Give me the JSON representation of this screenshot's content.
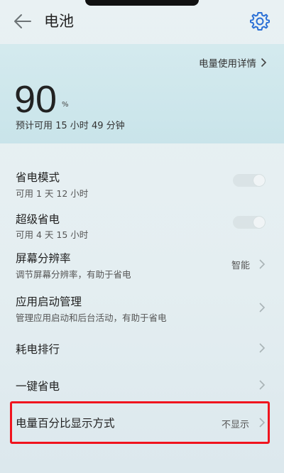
{
  "header": {
    "title": "电池",
    "back_icon": "arrow-left-icon",
    "settings_icon": "gear-icon"
  },
  "battery": {
    "detail_link": "电量使用详情",
    "percent": "90",
    "percent_unit": "%",
    "estimate": "预计可用 15 小时 49 分钟"
  },
  "settings": [
    {
      "id": "power-saving",
      "label": "省电模式",
      "sub": "可用 1 天 12 小时",
      "control": "toggle",
      "on": false
    },
    {
      "id": "ultra-power-saving",
      "label": "超级省电",
      "sub": "可用 4 天 15 小时",
      "control": "toggle",
      "on": false
    },
    {
      "id": "screen-resolution",
      "label": "屏幕分辨率",
      "sub": "调节屏幕分辨率，有助于省电",
      "value": "智能",
      "control": "chevron"
    },
    {
      "id": "app-launch",
      "label": "应用启动管理",
      "sub": "管理应用启动和后台活动，有助于省电",
      "control": "chevron"
    },
    {
      "id": "power-ranking",
      "label": "耗电排行",
      "control": "chevron"
    },
    {
      "id": "one-tap-saving",
      "label": "一键省电",
      "control": "chevron"
    },
    {
      "id": "percent-display",
      "label": "电量百分比显示方式",
      "value": "不显示",
      "control": "chevron",
      "highlighted": true
    }
  ],
  "colors": {
    "accent": "#2a6fd6",
    "highlight": "#f0141e"
  }
}
